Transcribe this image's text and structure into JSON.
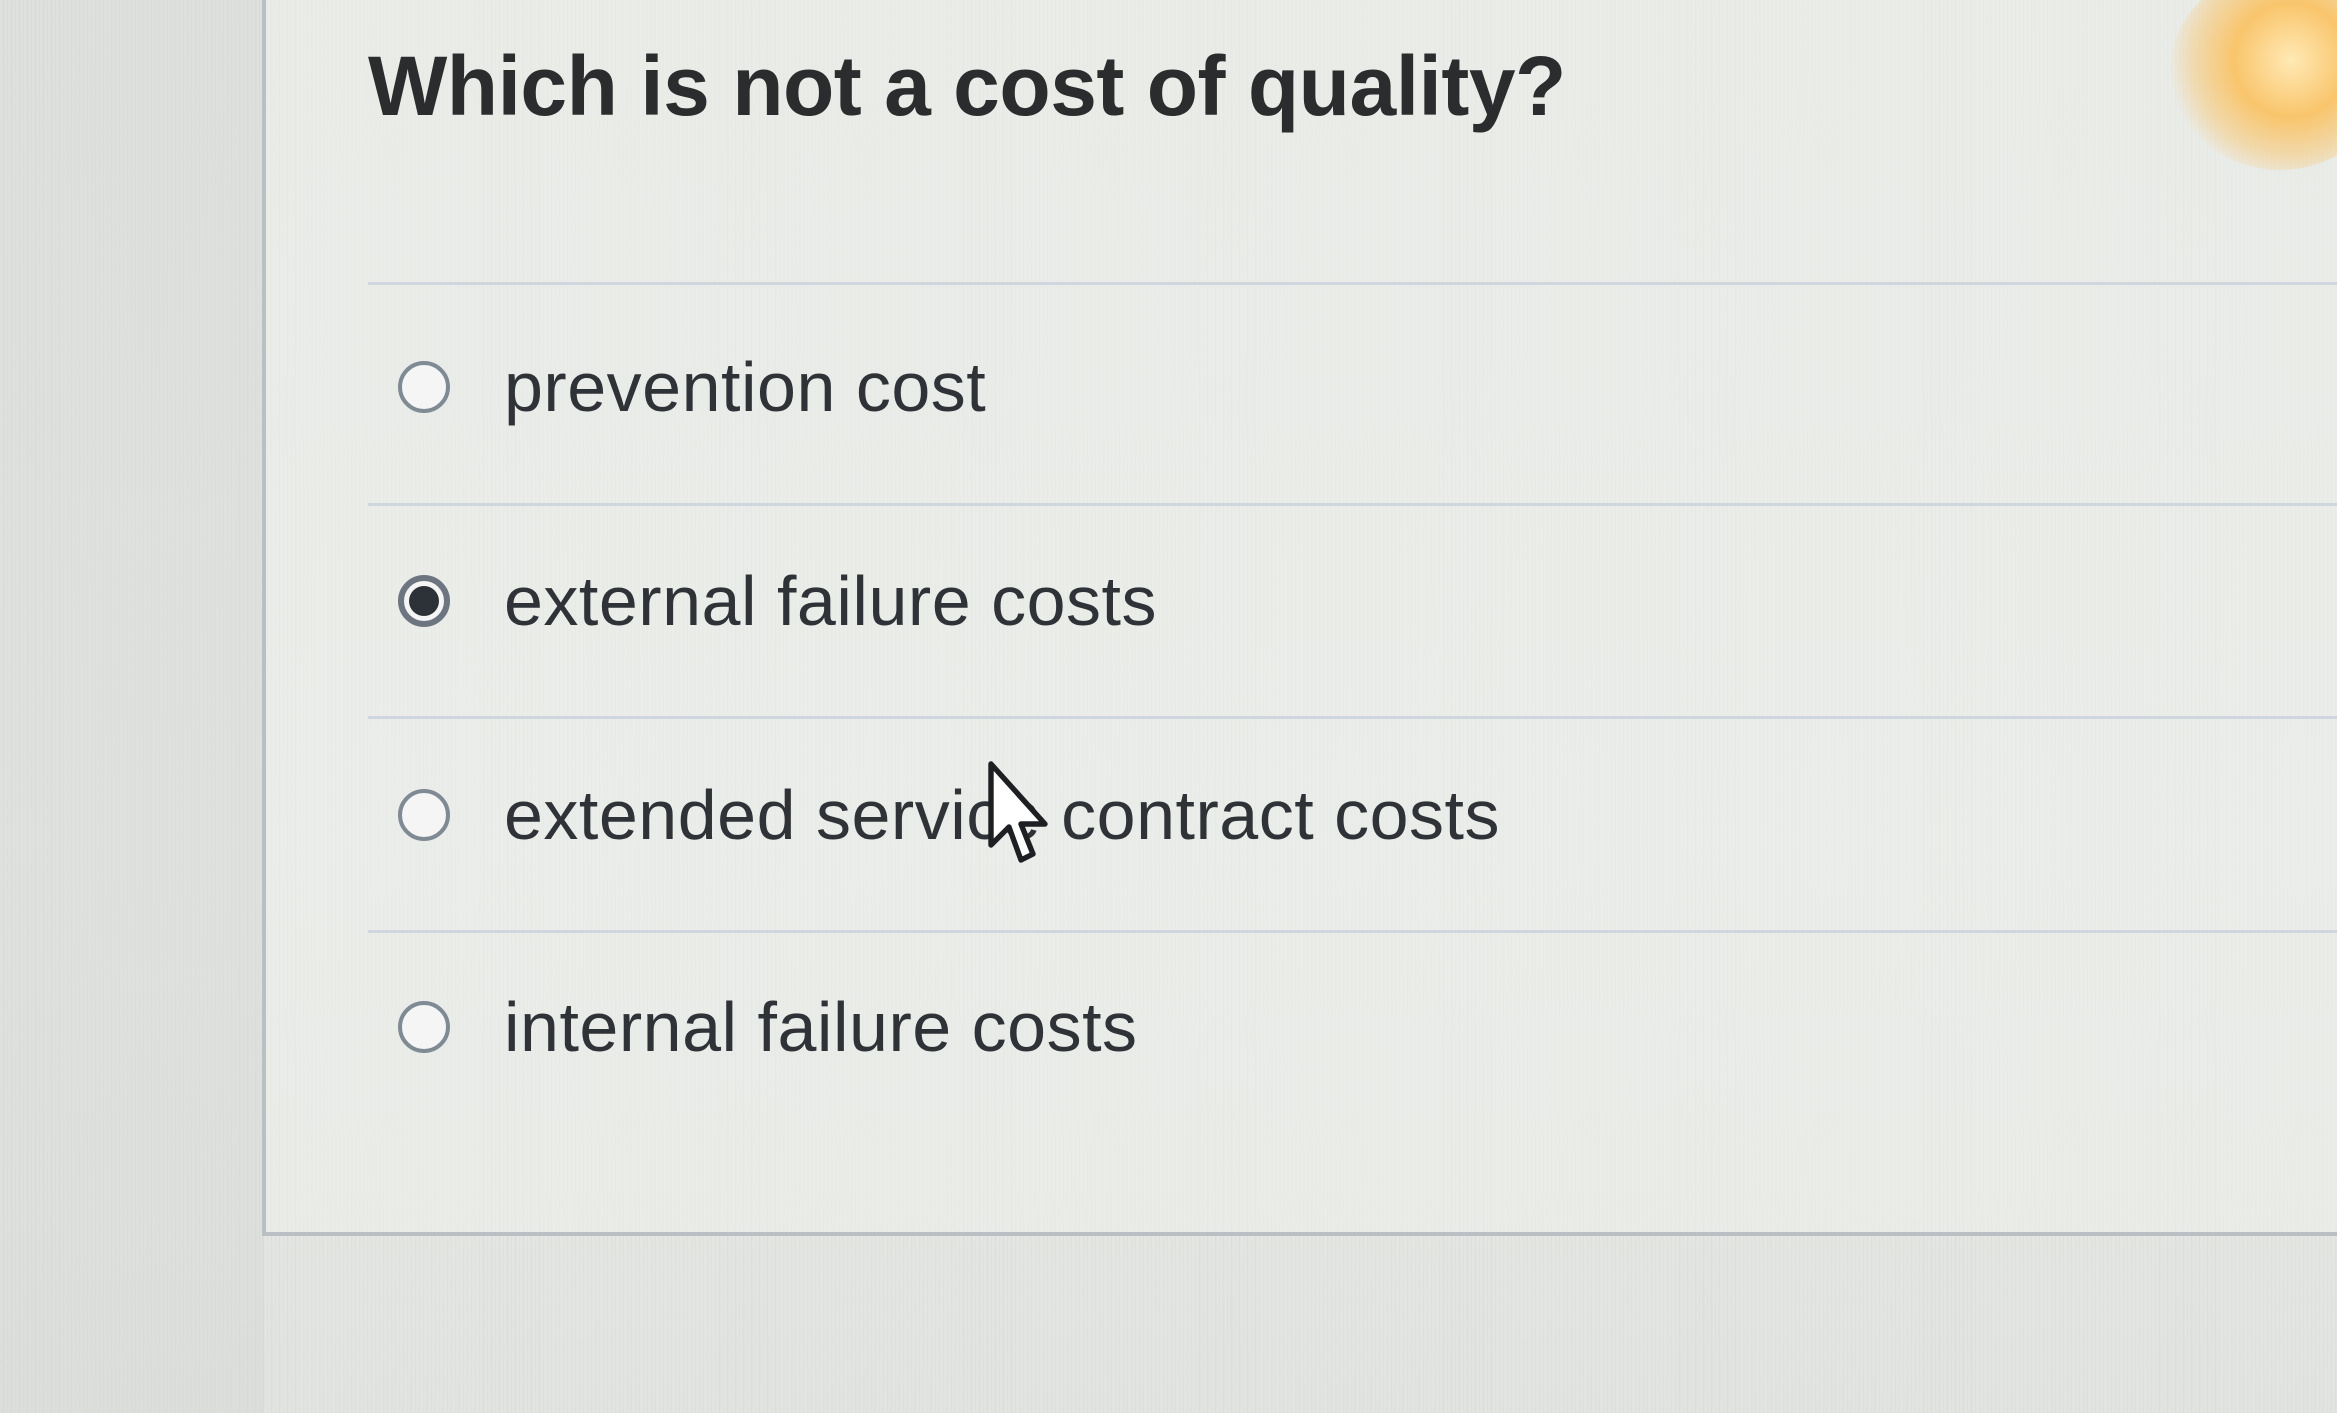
{
  "question": {
    "text": "Which is not a cost of quality?"
  },
  "options": [
    {
      "label": "prevention cost",
      "selected": false
    },
    {
      "label": "external failure costs",
      "selected": true
    },
    {
      "label": "extended service contract costs",
      "selected": false
    },
    {
      "label": "internal failure costs",
      "selected": false
    }
  ],
  "icons": {
    "cursor": "mouse-pointer-icon",
    "radio_unselected": "radio-unchecked-icon",
    "radio_selected": "radio-checked-icon"
  },
  "colors": {
    "background": "#e6e8e6",
    "text": "#2f3236",
    "divider": "#cfd6de",
    "radio_border": "#7f8a94",
    "radio_fill": "#2d3238"
  }
}
